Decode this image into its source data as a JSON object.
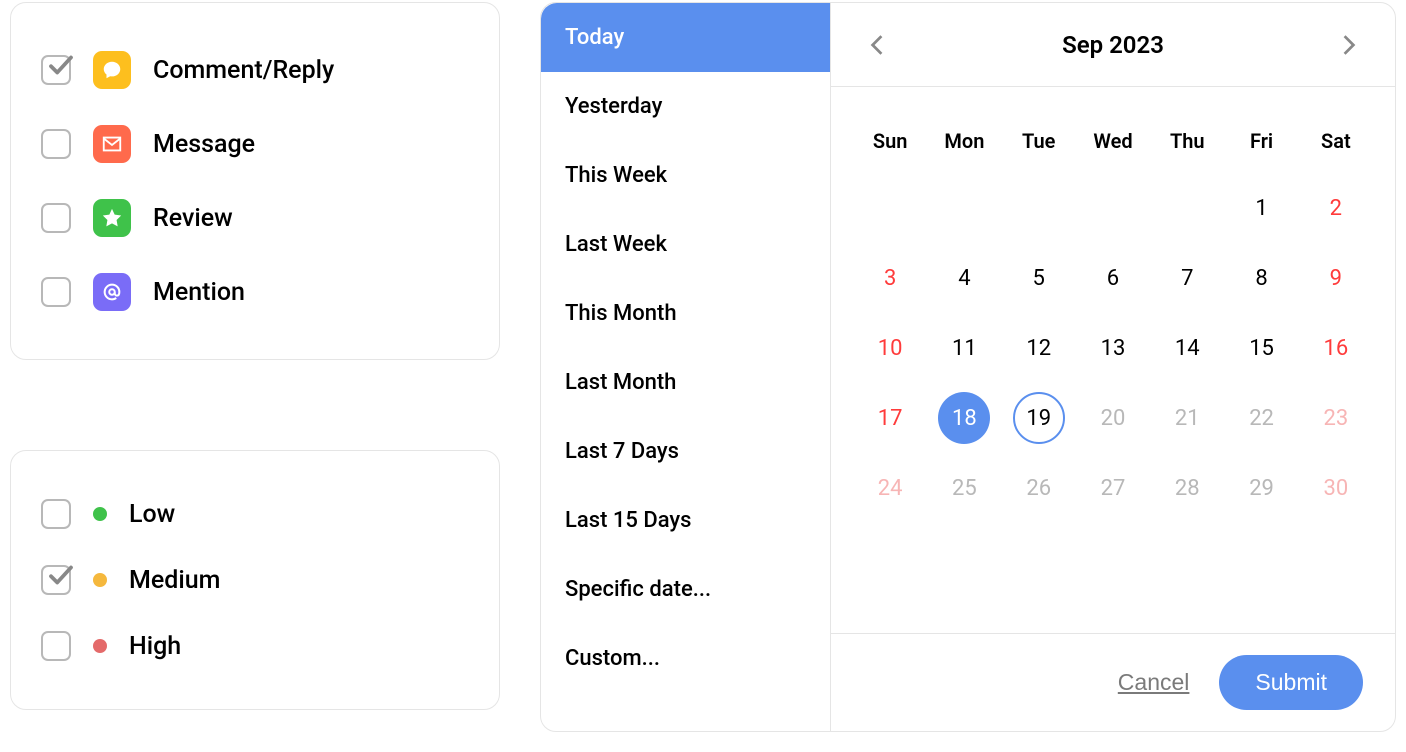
{
  "types": [
    {
      "label": "Comment/Reply",
      "icon": "comment",
      "color": "yellow",
      "checked": true
    },
    {
      "label": "Message",
      "icon": "mail",
      "color": "coral",
      "checked": false
    },
    {
      "label": "Review",
      "icon": "star",
      "color": "green",
      "checked": false
    },
    {
      "label": "Mention",
      "icon": "at",
      "color": "indigo",
      "checked": false
    }
  ],
  "priorities": [
    {
      "label": "Low",
      "dot": "green",
      "checked": false
    },
    {
      "label": "Medium",
      "dot": "amber",
      "checked": true
    },
    {
      "label": "High",
      "dot": "red",
      "checked": false
    }
  ],
  "presets": [
    "Today",
    "Yesterday",
    "This Week",
    "Last Week",
    "This Month",
    "Last Month",
    "Last 7 Days",
    "Last 15 Days",
    "Specific date...",
    "Custom..."
  ],
  "preset_selected": 0,
  "calendar": {
    "title": "Sep 2023",
    "dow": [
      "Sun",
      "Mon",
      "Tue",
      "Wed",
      "Thu",
      "Fri",
      "Sat"
    ],
    "selected": 18,
    "today": 19,
    "muted_from": 20,
    "weeks": [
      [
        "",
        "",
        "",
        "",
        "",
        "1",
        "2"
      ],
      [
        "3",
        "4",
        "5",
        "6",
        "7",
        "8",
        "9"
      ],
      [
        "10",
        "11",
        "12",
        "13",
        "14",
        "15",
        "16"
      ],
      [
        "17",
        "18",
        "19",
        "20",
        "21",
        "22",
        "23"
      ],
      [
        "24",
        "25",
        "26",
        "27",
        "28",
        "29",
        "30"
      ]
    ]
  },
  "buttons": {
    "cancel": "Cancel",
    "submit": "Submit"
  }
}
